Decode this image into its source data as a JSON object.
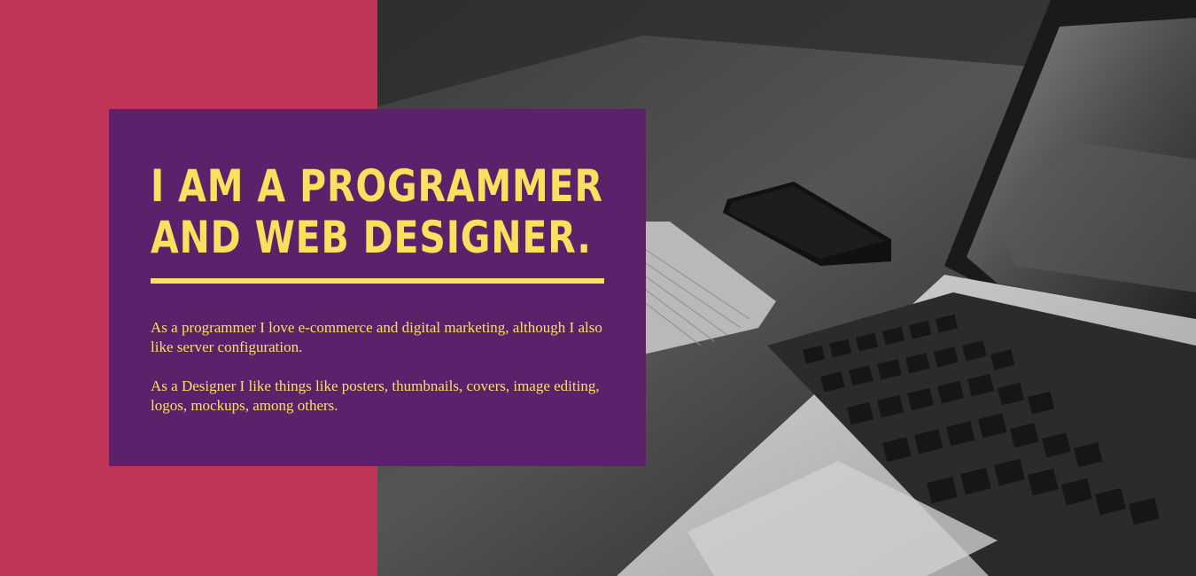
{
  "hero": {
    "headline_line1": "I am a programmer",
    "headline_line2": "and web designer.",
    "paragraph1": "As a programmer I love e-commerce and digital marketing, although I also like server configuration.",
    "paragraph2": "As a Designer I like things like posters, thumbnails, covers, image editing, logos, mockups, among others."
  },
  "colors": {
    "background_accent": "#bf3558",
    "card": "#5d206a",
    "text": "#f9e15f"
  },
  "image": {
    "subject": "laptop-on-desk-photo"
  }
}
